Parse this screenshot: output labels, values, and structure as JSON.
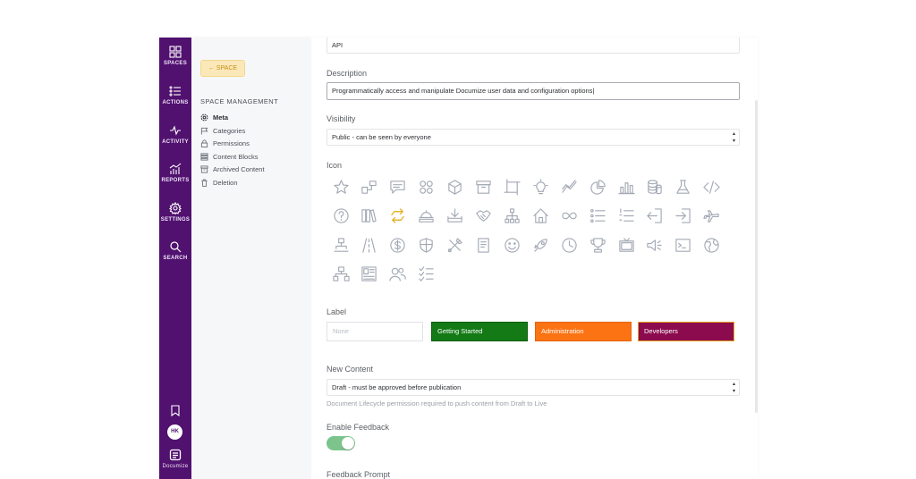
{
  "rail": {
    "items": [
      {
        "label": "SPACES",
        "icon": "grid-icon"
      },
      {
        "label": "ACTIONS",
        "icon": "list-icon"
      },
      {
        "label": "ACTIVITY",
        "icon": "pulse-icon"
      },
      {
        "label": "REPORTS",
        "icon": "chart-icon"
      },
      {
        "label": "SETTINGS",
        "icon": "gear-icon"
      },
      {
        "label": "SEARCH",
        "icon": "search-icon"
      }
    ],
    "avatar_initials": "HK",
    "brand_label": "Documize",
    "bookmark_icon": "bookmark-icon"
  },
  "sidebar": {
    "back_label": "SPACE",
    "section_heading": "SPACE MANAGEMENT",
    "items": [
      {
        "label": "Meta",
        "icon": "gear-icon",
        "active": true
      },
      {
        "label": "Categories",
        "icon": "flag-icon",
        "active": false
      },
      {
        "label": "Permissions",
        "icon": "lock-icon",
        "active": false
      },
      {
        "label": "Content Blocks",
        "icon": "blocks-icon",
        "active": false
      },
      {
        "label": "Archived Content",
        "icon": "archive-icon",
        "active": false
      },
      {
        "label": "Deletion",
        "icon": "trash-icon",
        "active": false
      }
    ]
  },
  "form": {
    "name_value": "API",
    "description_label": "Description",
    "description_value": "Programmatically access and manipulate Documize user data and configuration options",
    "visibility_label": "Visibility",
    "visibility_value": "Public - can be seen by everyone",
    "icon_label": "Icon",
    "label_label": "Label",
    "label_placeholder": "None",
    "labels": [
      {
        "name": "Getting Started",
        "color": "#137a16"
      },
      {
        "name": "Administration",
        "color": "#fb7313"
      },
      {
        "name": "Developers",
        "color": "#8c0b4e"
      }
    ],
    "new_content_label": "New Content",
    "new_content_value": "Draft - must be approved before publication",
    "new_content_hint": "Document Lifecycle permission required to push content from Draft to Live",
    "feedback_label": "Enable Feedback",
    "feedback_enabled": true,
    "feedback_prompt_label": "Feedback Prompt"
  },
  "icons": [
    "star-icon",
    "org-icon",
    "chat-icon",
    "apps-icon",
    "cube-icon",
    "box-icon",
    "crop-icon",
    "bulb-icon",
    "trend-icon",
    "pie-icon",
    "bar-chart-icon",
    "database-icon",
    "flask-icon",
    "code-icon",
    "help-icon",
    "library-icon",
    "sync-icon",
    "bell-tray-icon",
    "download-tray-icon",
    "handshake-icon",
    "hierarchy-icon",
    "home-icon",
    "infinity-icon",
    "bullet-list-icon",
    "numbered-list-icon",
    "exit-icon",
    "enter-icon",
    "plane-icon",
    "hierarchy-small-icon",
    "road-icon",
    "dollar-icon",
    "shield-icon",
    "tools-icon",
    "document-icon",
    "smile-icon",
    "rocket-icon",
    "clock-icon",
    "trophy-icon",
    "tv-icon",
    "speaker-icon",
    "terminal-icon",
    "globe-icon",
    "flow-icon",
    "newspaper-icon",
    "users-icon",
    "checklist-icon"
  ],
  "colors": {
    "rail": "#50116f",
    "back_button_bg": "#fbe8b8",
    "toggle_on": "#7cc48c",
    "icon_stroke": "#a3a9b4",
    "icon_selected": "#e0a80d"
  }
}
